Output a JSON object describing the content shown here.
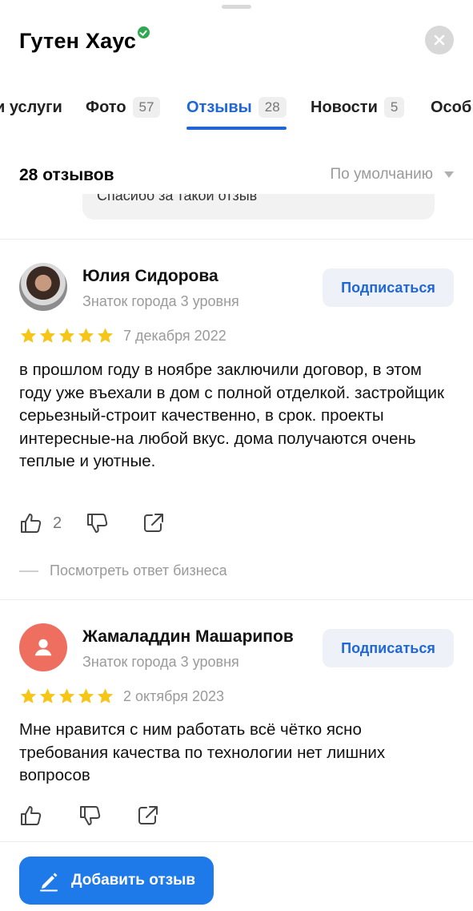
{
  "business": {
    "name": "Гутен Хаус"
  },
  "tabs": [
    {
      "label": "и услуги",
      "count": ""
    },
    {
      "label": "Фото",
      "count": "57"
    },
    {
      "label": "Отзывы",
      "count": "28",
      "active": true
    },
    {
      "label": "Новости",
      "count": "5"
    },
    {
      "label": "Особ",
      "count": ""
    }
  ],
  "reviews_header": {
    "count_label": "28 отзывов",
    "sort_label": "По умолчанию"
  },
  "previous_reply": {
    "text": "Спасибо за такой отзыв"
  },
  "reviews": [
    {
      "author": "Юлия Сидорова",
      "level": "Знаток города 3 уровня",
      "subscribe_label": "Подписаться",
      "rating": 5,
      "date": "7 декабря 2022",
      "text": "в прошлом году  в ноябре заключили договор, в этом году уже въехали в дом с полной отделкой. застройщик серьезный-строит качественно, в срок. проекты интересные-на любой вкус. дома получаются очень теплые и уютные.",
      "likes": "2",
      "business_reply_link": "Посмотреть ответ бизнеса"
    },
    {
      "author": "Жамаладдин Машарипов",
      "level": "Знаток города 3 уровня",
      "subscribe_label": "Подписаться",
      "rating": 5,
      "date": "2 октября 2023",
      "text": "Мне нравится с ним работать всё чётко ясно требования качества по технологии нет лишних вопросов",
      "likes": ""
    }
  ],
  "footer": {
    "add_review_label": "Добавить отзыв"
  },
  "colors": {
    "accent": "#1f67d8",
    "button": "#1f7ae9",
    "star": "#f5c518",
    "avatar_placeholder": "#ee6f5f"
  }
}
